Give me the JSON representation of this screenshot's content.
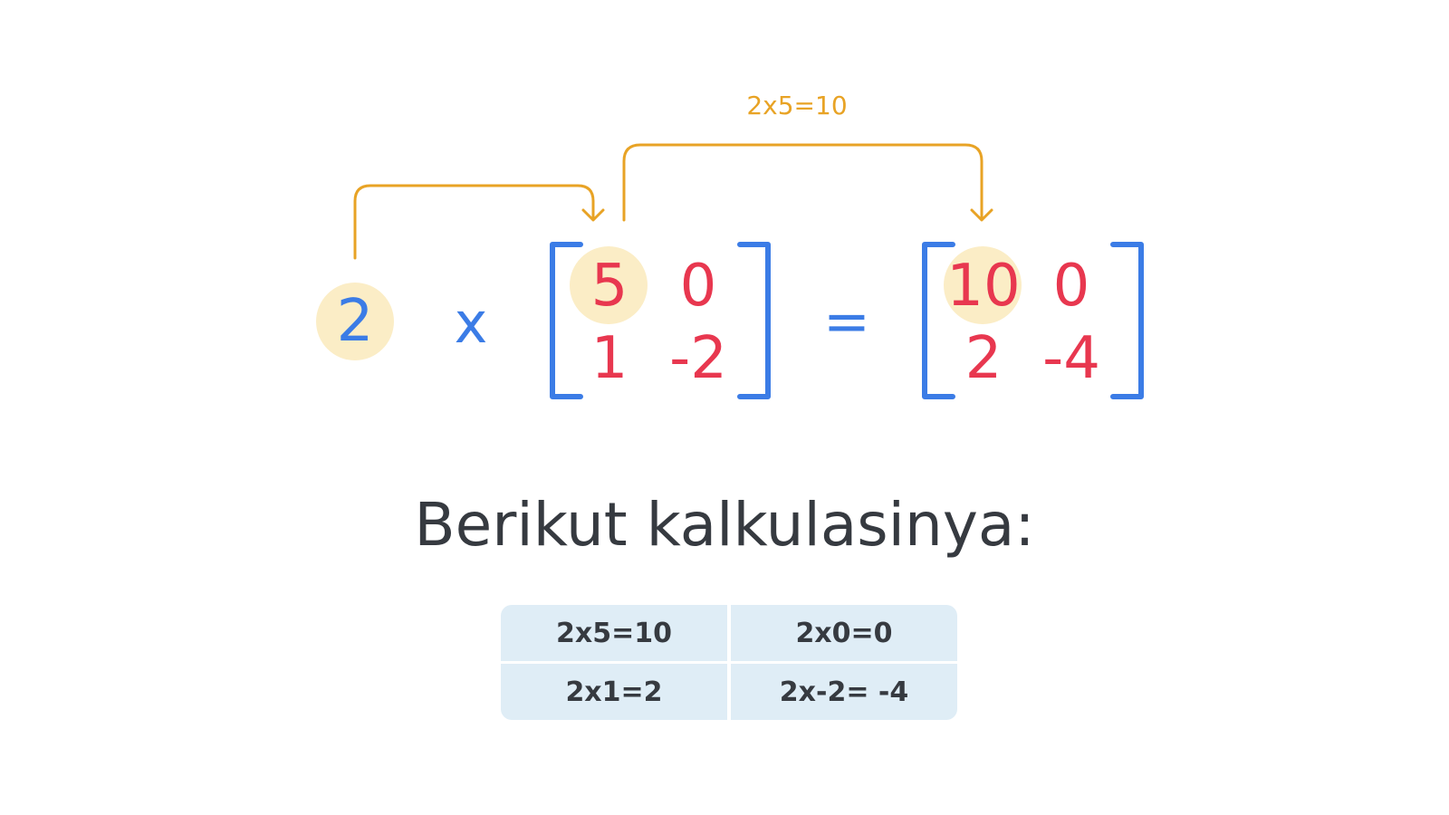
{
  "annotation": {
    "label": "2x5=10"
  },
  "colors": {
    "blue": "#3B7CE6",
    "red": "#E8374F",
    "orange": "#E8A325",
    "highlight": "#FBEDC6",
    "table_bg": "#DFEDF6",
    "text": "#363A40"
  },
  "equation": {
    "scalar": "2",
    "times": "x",
    "equals": "=",
    "matrix_a": [
      [
        "5",
        "0"
      ],
      [
        "1",
        "-2"
      ]
    ],
    "matrix_result": [
      [
        "10",
        "0"
      ],
      [
        "2",
        "-4"
      ]
    ]
  },
  "heading": "Berikut kalkulasinya:",
  "calculations": [
    [
      "2x5=10",
      "2x0=0"
    ],
    [
      "2x1=2",
      "2x-2= -4"
    ]
  ]
}
